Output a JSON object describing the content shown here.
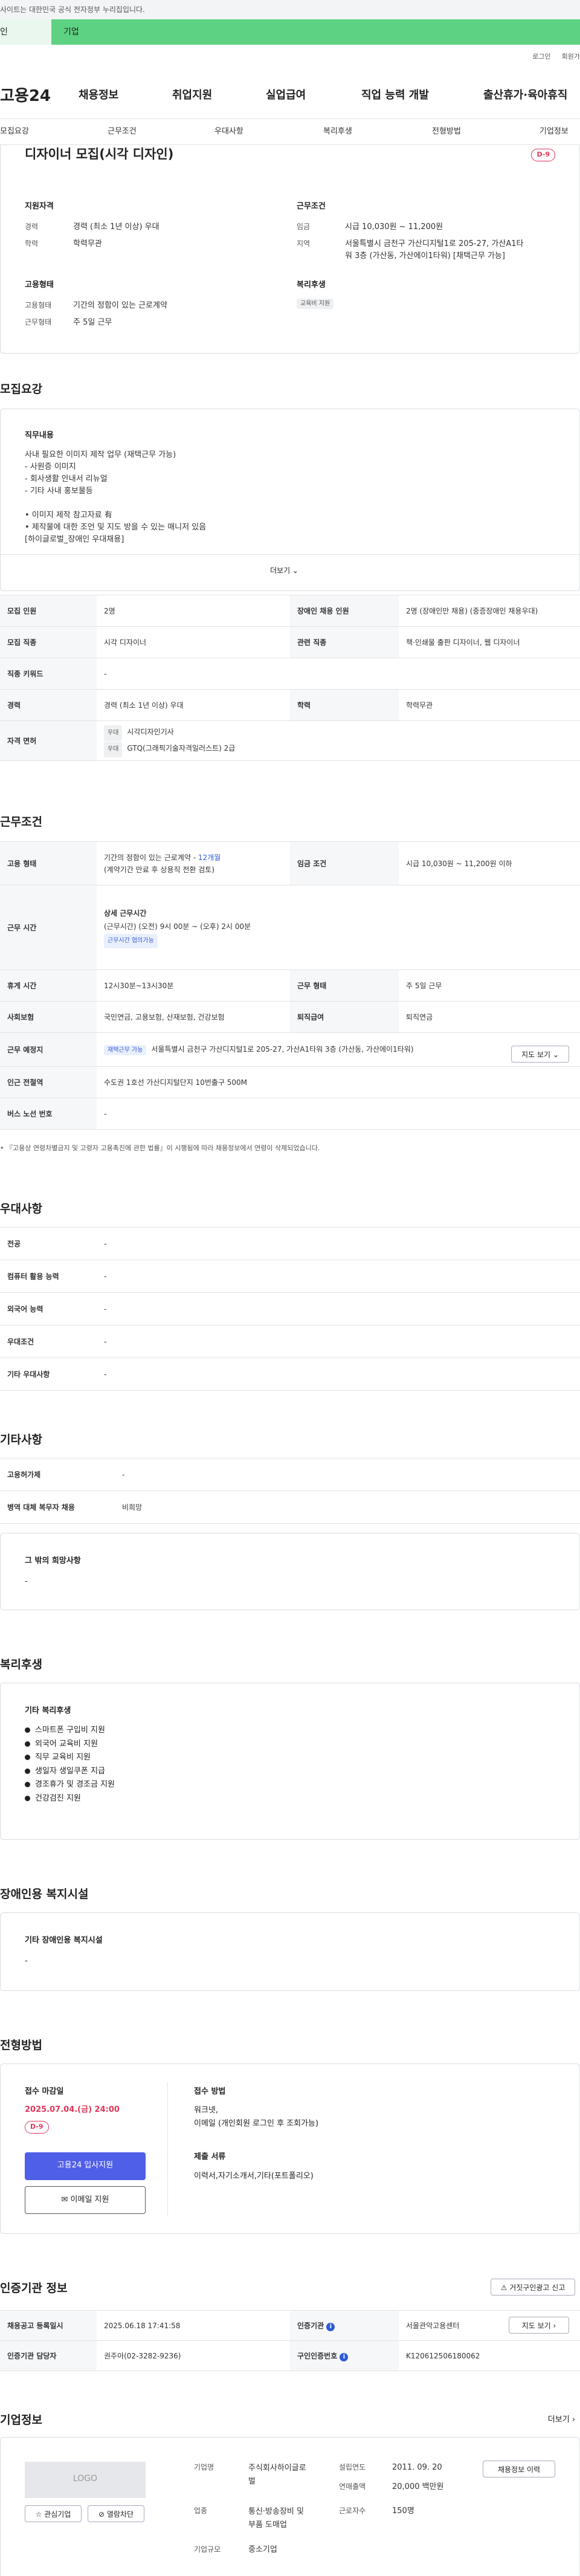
{
  "top_notice": "사이트는 대한민국 공식 전자정부 누리집입니다.",
  "green_tabs": [
    "인",
    "기업"
  ],
  "util_links": [
    "로그인",
    "회원가"
  ],
  "gnb": {
    "logo": "고용24",
    "menu": [
      "채용정보",
      "취업지원",
      "실업급여",
      "직업 능력 개발",
      "출산휴가·육아휴직"
    ]
  },
  "subnav": [
    "모집요강",
    "근무조건",
    "우대사항",
    "복리후생",
    "전형방법",
    "기업정보"
  ],
  "summary": {
    "title": "디자이너 모집(시각 디자인)",
    "dday": "D-9",
    "qual_heading": "지원자격",
    "career_label": "경력",
    "career_value": "경력 (최소 1년 이상) 우대",
    "edu_label": "학력",
    "edu_value": "학력무관",
    "cond_heading": "근무조건",
    "wage_label": "임금",
    "wage_value": "시급 10,030원 ~ 11,200원",
    "area_label": "지역",
    "area_value_1": "서울특별시 금천구 가산디지털1로 205-27, 가산A1타",
    "area_value_2": "워 3층 (가산동, 가산에이1타워) [채택근무 가능]",
    "type_heading": "고용형태",
    "etype_label": "고용형태",
    "etype_value": "기간의 정함이 있는 근로계약",
    "days_label": "근무형태",
    "days_value": "주 5일 근무",
    "welfare_heading": "복리후생",
    "welfare_tag": "교육비 지원"
  },
  "recruit": {
    "heading": "모집요강",
    "duty_heading": "직무내용",
    "duty_lines": [
      "사내 필요한 이미지 제작 업무 (재택근무 가능)",
      "- 사원증 이미지",
      "- 회사생활 안내서 리뉴얼",
      "- 기타 사내 홍보물등",
      "",
      "• 이미지 제작 참고자료 有",
      "• 제작물에 대한 조언 및 지도 방을 수 있는 매니저 있음",
      "[하이글로벌_장애인 우대채용]"
    ],
    "more": "더보기 ⌄",
    "rows": [
      {
        "k1": "모집 인원",
        "v1": "2명",
        "k2": "장애인 채용 인원",
        "v2": "2명 (장애인만 채용) (중증장애인 채용우대)"
      },
      {
        "k1": "모집 직종",
        "v1": "시각 디자이너",
        "k2": "관련 직종",
        "v2": "책·인쇄물 출판 디자이너, 웹 디자이너"
      },
      {
        "k1": "직종 키워드",
        "v1": "-"
      },
      {
        "k1": "경력",
        "v1": "경력 (최소 1년 이상) 우대",
        "k2": "학력",
        "v2": "학력무관"
      }
    ],
    "license_label": "자격 면허",
    "license_tag": "우대",
    "license_1": "시각디자인기사",
    "license_2": "GTQ(그래픽기술자격일러스트) 2급"
  },
  "work": {
    "heading": "근무조건",
    "etype_k": "고용 형태",
    "etype_v1": "기간의 정함이 있는 근로계약 - ",
    "etype_v1_link": "12개월",
    "etype_v2": "(계약기간 만료 후 상용직 전환 검토)",
    "wage_k": "임금 조건",
    "wage_v": "시급 10,030원 ~ 11,200원 이하",
    "hours_k": "근무 시간",
    "hours_title": "상세 근무시간",
    "hours_v": "(근무시간) (오전) 9시 00분 ~ (오후) 2시 00분",
    "hours_tag": "근무시간 협의가능",
    "rest_k": "휴게 시간",
    "rest_v": "12시30분~13시30분",
    "form_k": "근무 형태",
    "form_v": "주 5일 근무",
    "ins_k": "사회보험",
    "ins_v": "국민연금, 고용보험, 산재보험, 건강보험",
    "ret_k": "퇴직급여",
    "ret_v": "퇴직연금",
    "place_k": "근무 예정지",
    "place_tag": "재택근무 가능",
    "place_v": "서울특별시 금천구 가산디지털1로 205-27, 가산A1타워 3층 (가산동, 가산에이1타워)",
    "map_btn": "지도 보기 ⌄",
    "subway_k": "인근 전철역",
    "subway_v": "수도권 1호선 가산디지털단지 10번출구 500M",
    "bus_k": "버스 노선 번호",
    "bus_v": "-",
    "footnote": "• 『고용상 연령차별금지 및 고령자 고용촉진에 관한 법률』이 시행됨에 따라 채용정보에서 연령이 삭제되었습니다."
  },
  "pref": {
    "heading": "우대사항",
    "rows": [
      {
        "k": "전공",
        "v": "-"
      },
      {
        "k": "컴퓨터 활용 능력",
        "v": "-"
      },
      {
        "k": "외국어 능력",
        "v": "-"
      },
      {
        "k": "우대조건",
        "v": "-"
      },
      {
        "k": "기타 우대사항",
        "v": "-"
      }
    ]
  },
  "etc": {
    "heading": "기타사항",
    "rows": [
      {
        "k": "고용허가제",
        "v": "-"
      },
      {
        "k": "병역 대체 복무자 채용",
        "v": "비희망"
      }
    ],
    "wish_title": "그 밖의 희망사항",
    "wish_value": "-"
  },
  "welfare": {
    "heading": "복리후생",
    "sub": "기타 복리후생",
    "items": [
      "스마트폰 구입비 지원",
      "외국어 교육비 지원",
      "직무 교육비 지원",
      "생일자 생일쿠폰 지급",
      "경조휴가 및 경조금 지원",
      "건강검진 지원"
    ]
  },
  "disabled": {
    "heading": "장애인용 복지시설",
    "sub": "기타 장애인용 복지시설",
    "value": "-"
  },
  "process": {
    "heading": "전형방법",
    "deadline_label": "접수 마감일",
    "deadline_value": "2025.07.04.(금) 24:00",
    "dday": "D-9",
    "apply_btn": "고용24 입사지원",
    "email_btn": "이메일 지원",
    "method_label": "접수 방법",
    "method_1": "워크넷,",
    "method_2": "이메일 (개인회원 로그인 후 조회가능)",
    "docs_label": "제출 서류",
    "docs_value": "이력서,자기소개서,기타(포트폴리오)"
  },
  "cert": {
    "heading": "인증기관 정보",
    "report_btn": "거짓구인광고 신고",
    "reg_k": "채용공고 등록일시",
    "reg_v": "2025.06.18 17:41:58",
    "org_k": "인증기관",
    "org_v": "서울관악고용센터",
    "map_btn": "지도 보기 ›",
    "mgr_k": "인증기관 담당자",
    "mgr_v": "권주아(02-3282-9236)",
    "no_k": "구인인증번호",
    "no_v": "K120612506180062"
  },
  "company": {
    "heading": "기업정보",
    "more": "더보기 ›",
    "logo": "LOGO",
    "fav_btn": "관심기업",
    "block_btn": "열람차단",
    "name_k": "기업명",
    "name_v1": "주식회사하이글로",
    "name_v2": "벌",
    "year_k": "설립연도",
    "year_v": "2011. 09. 20",
    "info_btn": "채용정보 이력",
    "sales_k": "연매출액",
    "sales_v": "20,000 백만원",
    "ind_k": "업종",
    "ind_v1": "통신·방송장비 및",
    "ind_v2": "부품 도매업",
    "emp_k": "근로자수",
    "emp_v": "150명",
    "scale_k": "기업규모",
    "scale_v": "중소기업"
  }
}
